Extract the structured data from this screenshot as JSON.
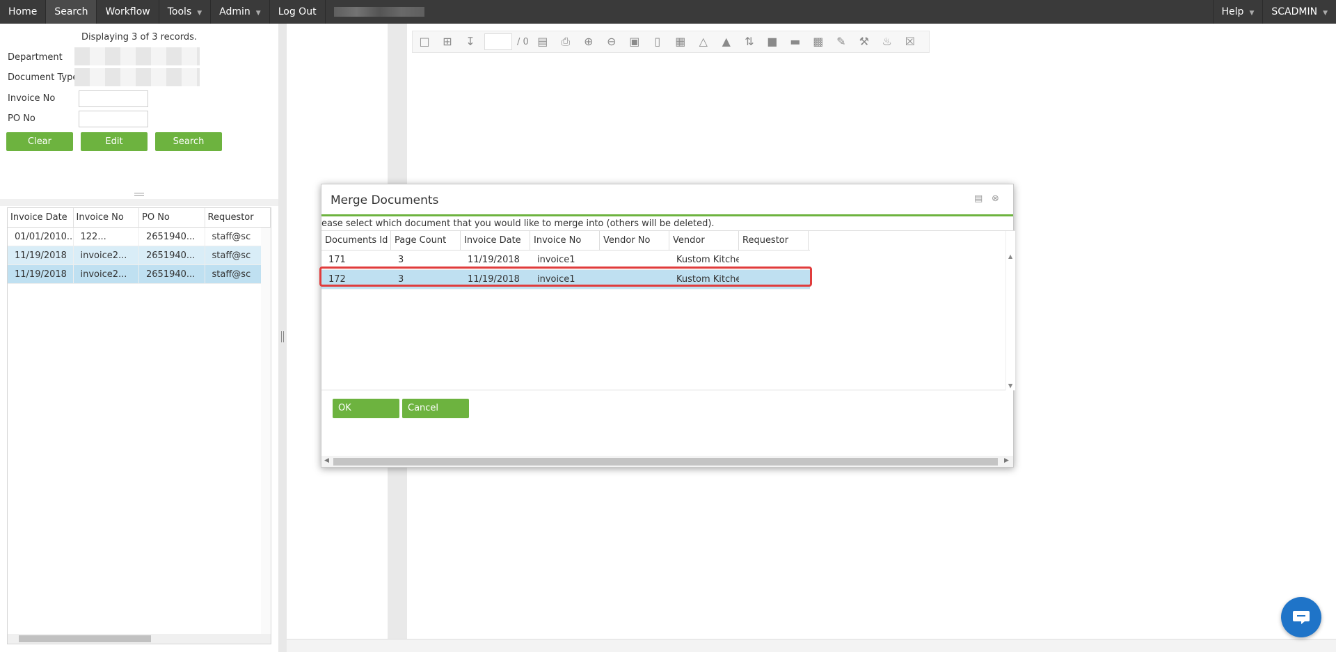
{
  "nav": {
    "home": "Home",
    "search": "Search",
    "workflow": "Workflow",
    "tools": "Tools",
    "admin": "Admin",
    "logout": "Log Out",
    "help": "Help",
    "user": "SCADMIN"
  },
  "search_panel": {
    "records": "Displaying 3 of 3 records.",
    "department_label": "Department",
    "doctype_label": "Document Type",
    "invoice_label": "Invoice No",
    "po_label": "PO No",
    "invoice_value": "",
    "po_value": "",
    "clear": "Clear",
    "edit": "Edit",
    "search": "Search"
  },
  "results": {
    "columns": [
      "Invoice Date",
      "Invoice No",
      "PO No",
      "Requestor"
    ],
    "rows": [
      [
        "01/01/2010...",
        "122...",
        "2651940...",
        "staff@sc"
      ],
      [
        "11/19/2018",
        "invoice2...",
        "2651940...",
        "staff@sc"
      ],
      [
        "11/19/2018",
        "invoice2...",
        "2651940...",
        "staff@sc"
      ]
    ]
  },
  "toolbar": {
    "page_value": "",
    "page_total": "/ 0"
  },
  "dialog": {
    "title": "Merge Documents",
    "message": "ease select which document that you would like to merge into (others will be deleted).",
    "columns": [
      "Documents Id",
      "Page Count",
      "Invoice Date",
      "Invoice No",
      "Vendor No",
      "Vendor",
      "Requestor"
    ],
    "rows": [
      [
        "171",
        "3",
        "11/19/2018",
        "invoice1",
        "",
        "Kustom Kitche",
        ""
      ],
      [
        "172",
        "3",
        "11/19/2018",
        "invoice1",
        "",
        "Kustom Kitche",
        ""
      ]
    ],
    "ok": "OK",
    "cancel": "Cancel"
  },
  "colors": {
    "nav_bg": "#3a3a3a",
    "accent_green": "#6db33f",
    "selection_blue": "#bfe0f1",
    "highlight_red": "#e03c3c",
    "chat_blue": "#1f74c8"
  }
}
